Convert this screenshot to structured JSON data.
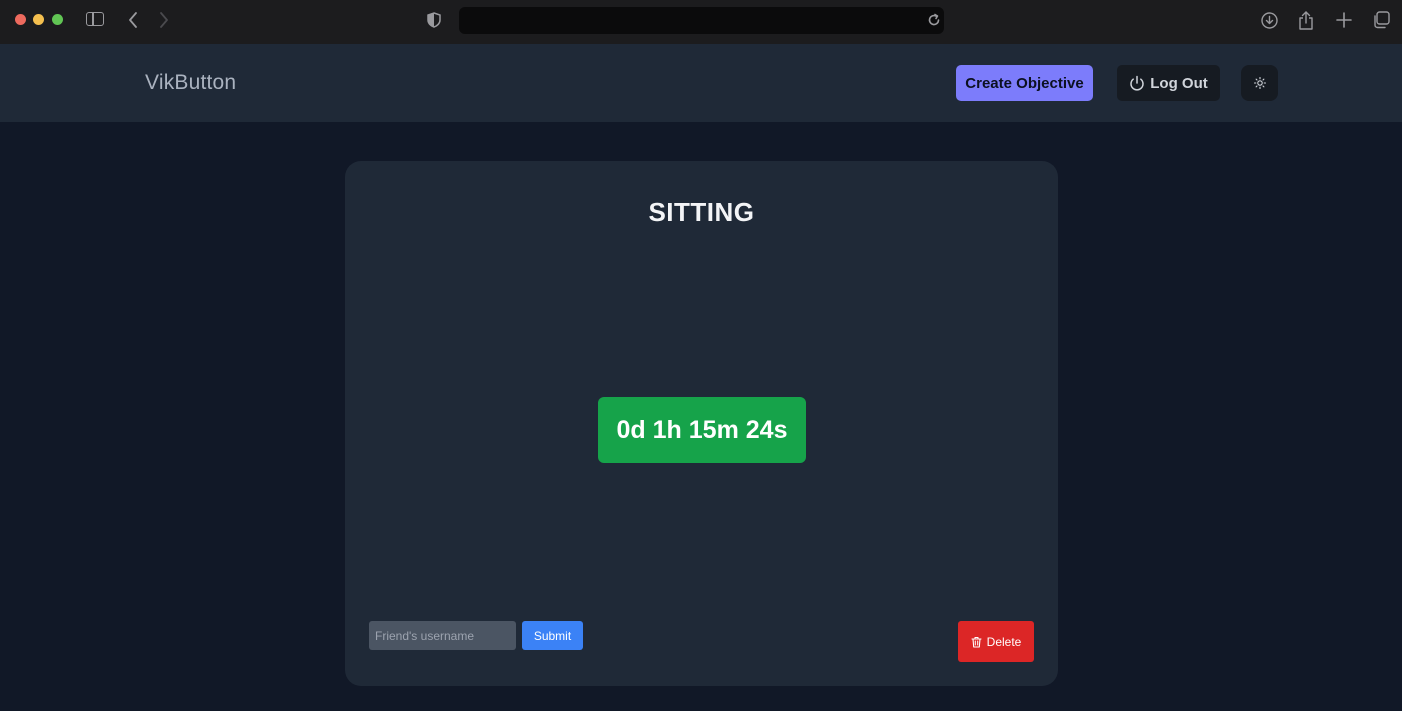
{
  "app": {
    "brand": "VikButton"
  },
  "header": {
    "create_label": "Create Objective",
    "logout_label": "Log Out"
  },
  "card": {
    "title": "SITTING",
    "timer": "0d 1h 15m 24s"
  },
  "share": {
    "placeholder": "Friend's username",
    "value": "",
    "submit_label": "Submit"
  },
  "actions": {
    "delete_label": "Delete"
  },
  "colors": {
    "page_bg": "#111827",
    "card_bg": "#1f2937",
    "accent": "#7c7cfb",
    "timer_green": "#16a34a",
    "submit_blue": "#3b82f6",
    "delete_red": "#dc2626"
  },
  "icons": {
    "logout": "power-icon",
    "theme": "sun-icon",
    "delete": "trash-icon"
  }
}
